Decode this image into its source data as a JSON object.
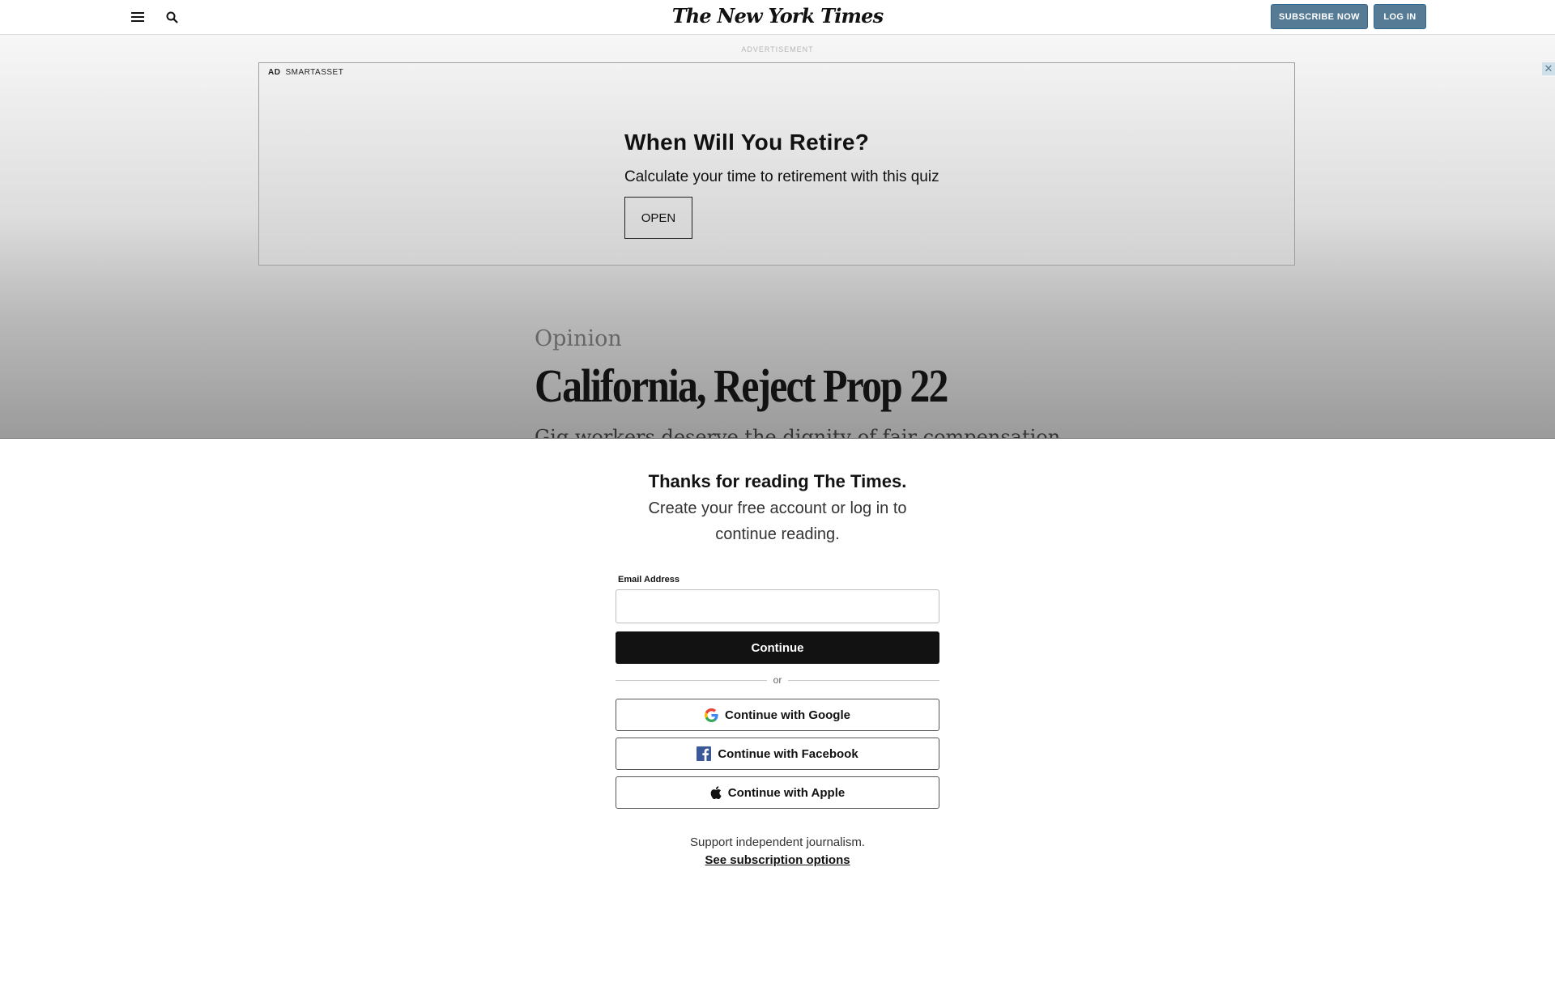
{
  "header": {
    "logo_text": "The New York Times",
    "subscribe_label": "SUBSCRIBE NOW",
    "login_label": "LOG IN",
    "menu_icon": "hamburger-menu-icon",
    "search_icon": "search-icon",
    "button_color": "#567b95"
  },
  "ad": {
    "section_label": "ADVERTISEMENT",
    "tag": "AD",
    "sponsor": "SMARTASSET",
    "headline": "When Will You Retire?",
    "subtext": "Calculate your time to retirement with this quiz",
    "cta_label": "OPEN",
    "close_glyph": "✕"
  },
  "article": {
    "kicker": "Opinion",
    "headline": "California, Reject Prop 22",
    "dek": "Gig workers deserve the dignity of fair compensation"
  },
  "regwall": {
    "title": "Thanks for reading The Times.",
    "subtitle": "Create your free account or log in to continue reading.",
    "email_label": "Email Address",
    "email_value": "",
    "continue_label": "Continue",
    "or_label": "or",
    "google_label": "Continue with Google",
    "facebook_label": "Continue with Facebook",
    "apple_label": "Continue with Apple",
    "support_text": "Support independent journalism.",
    "subscription_link": "See subscription options"
  }
}
